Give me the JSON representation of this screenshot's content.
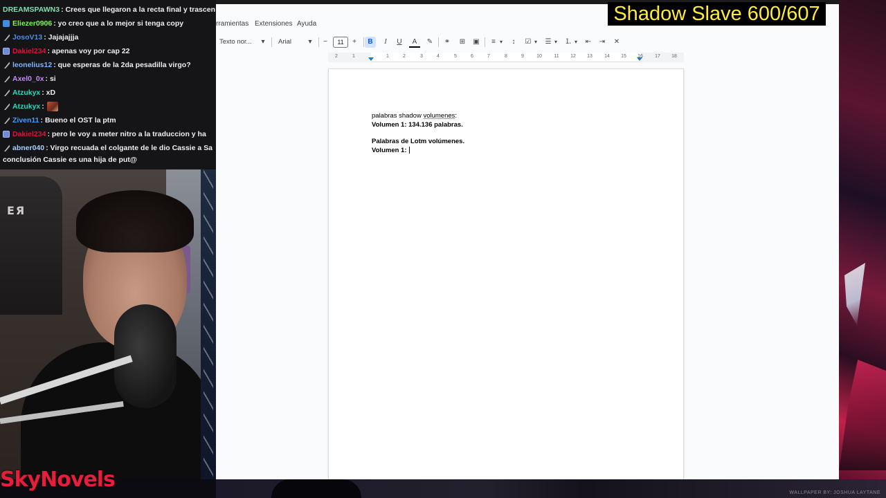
{
  "overlay": {
    "title": "Shadow Slave 600/607",
    "brand_logo": "SkyNovels",
    "wallpaper_credit": "WALLPAPER BY: JOSHUA LAYTANE"
  },
  "chat": {
    "messages": [
      {
        "user": "DREAMSPAWN3",
        "user_color": "#7fe0b0",
        "badge": "none",
        "text": ": Crees que llegaron a la recta final y trascen"
      },
      {
        "user": "Eliezer0906",
        "user_color": "#7cf94c",
        "badge": "prime",
        "text": ": yo creo que a lo mejor si tenga copy"
      },
      {
        "user": "JosoV13",
        "user_color": "#4d8fe6",
        "badge": "mod",
        "text": ": Jajajajjja"
      },
      {
        "user": "Dakiel234",
        "user_color": "#e0103c",
        "badge": "gift",
        "text": ": apenas voy por cap 22"
      },
      {
        "user": "leonelius12",
        "user_color": "#7fb4ff",
        "badge": "mod",
        "text": ": que esperas de la 2da pesadilla virgo?"
      },
      {
        "user": "Axel0_0x",
        "user_color": "#c38bf5",
        "badge": "mod",
        "text": ": si"
      },
      {
        "user": "Atzukyx",
        "user_color": "#2bd9c0",
        "badge": "mod",
        "text": ": xD"
      },
      {
        "user": "Atzukyx",
        "user_color": "#2bd9c0",
        "badge": "mod",
        "text": ":"
      },
      {
        "user": "Ziven11",
        "user_color": "#3ea0ff",
        "badge": "mod",
        "text": ": Bueno el OST la ptm"
      },
      {
        "user": "Dakiel234",
        "user_color": "#e0103c",
        "badge": "gift",
        "text": ": pero le voy a meter nitro a la traduccion y ha"
      },
      {
        "user": "abner040",
        "user_color": "#a8d0ff",
        "badge": "mod",
        "text": ": Virgo recuada el colgante de le dio Cassie a Sa"
      },
      {
        "user": "",
        "user_color": "#ffffff",
        "badge": "none",
        "text": "conclusión Cassie es una hija de put@"
      }
    ]
  },
  "docs": {
    "menu": [
      "rramientas",
      "Extensiones",
      "Ayuda"
    ],
    "toolbar": {
      "style_select": "Texto nor...",
      "font_select": "Arial",
      "font_size": "11",
      "decrease": "−",
      "increase": "+"
    },
    "ruler_ticks": [
      "2",
      "1",
      "1",
      "2",
      "3",
      "4",
      "5",
      "6",
      "7",
      "8",
      "9",
      "10",
      "11",
      "12",
      "13",
      "14",
      "15",
      "16",
      "17",
      "18"
    ],
    "content": {
      "line1_pre": "palabras shadow ",
      "line1_underlined": "volumenes",
      "line1_post": ":",
      "line2": "Volumen 1: 134.136 palabras.",
      "line3": "Palabras de Lotm volúmenes.",
      "line4": "Volumen 1:"
    }
  },
  "colors": {
    "title_fg": "#ffeb3b",
    "title_bg": "#000000",
    "brand": "#e51e3c",
    "docs_active": "#d3e3fd"
  }
}
